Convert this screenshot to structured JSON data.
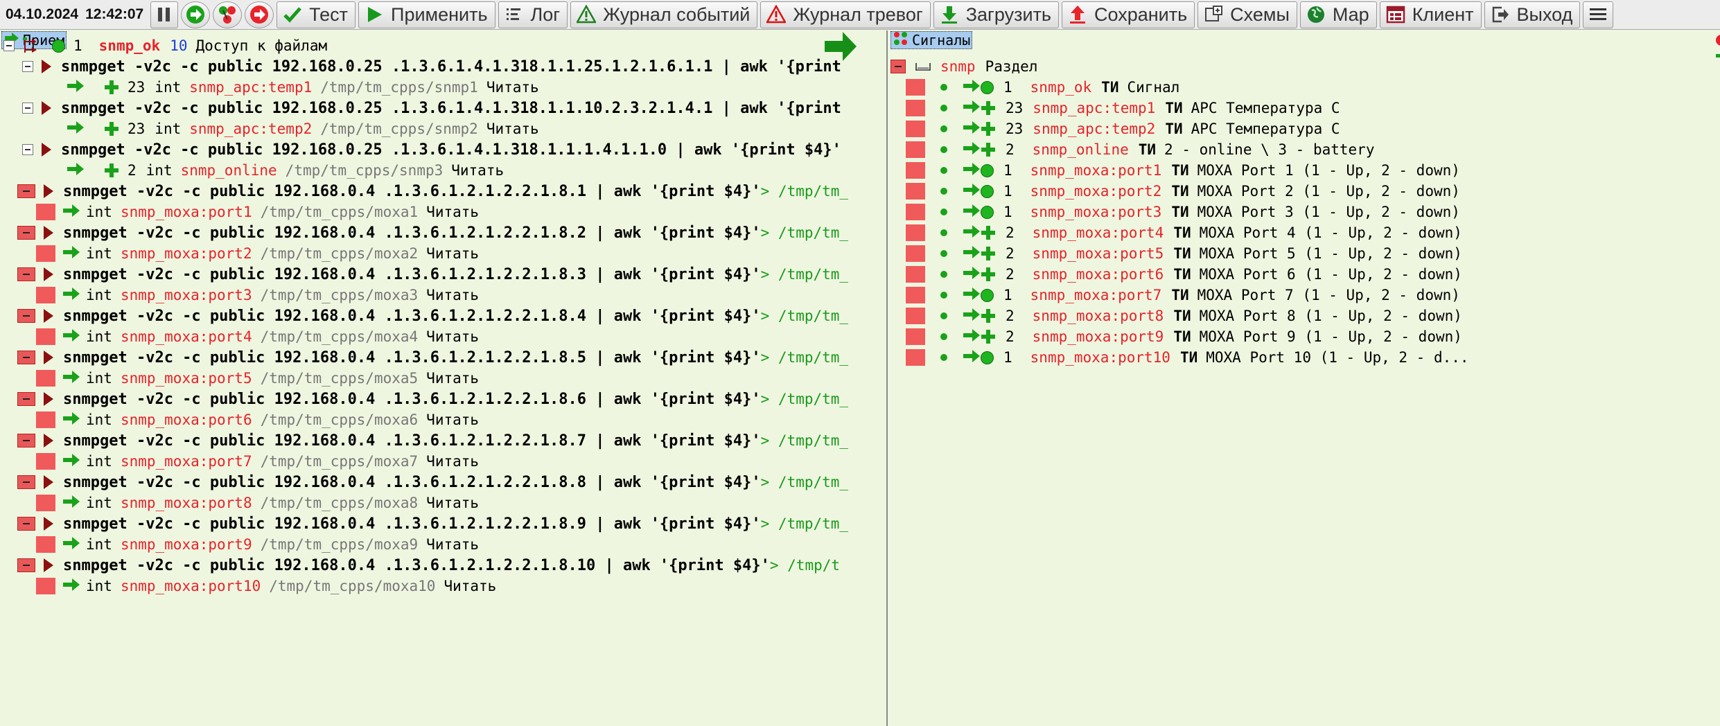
{
  "toolbar": {
    "date": "04.10.2024",
    "time": "12:42:07",
    "buttons": {
      "test": "Тест",
      "apply": "Применить",
      "log": "Лог",
      "events": "Журнал событий",
      "alarms": "Журнал тревог",
      "load": "Загрузить",
      "save": "Сохранить",
      "schemes": "Схемы",
      "map": "Мар",
      "client": "Клиент",
      "exit": "Выход"
    },
    "icons": {
      "pause": "pause-icon",
      "forward": "green-forward-icon",
      "tree": "tree-icon",
      "red_forward": "red-forward-icon",
      "test": "checkmark-icon",
      "apply": "play-icon",
      "log": "log-icon",
      "events": "warning-icon",
      "alarms": "warning-red-icon",
      "load": "download-icon",
      "save": "upload-icon",
      "schemes": "schemes-icon",
      "map": "globe-icon",
      "client": "client-icon",
      "exit": "exit-icon",
      "menu": "menu-icon"
    }
  },
  "left": {
    "header": "Прием",
    "root": {
      "num": "1",
      "name": "snmp_ok",
      "count": "10",
      "desc": "Доступ к файлам"
    },
    "groups": [
      {
        "style": "white",
        "cmd": "snmpget -v2c -c public 192.168.0.25 .1.3.6.1.4.1.318.1.1.25.1.2.1.6.1.1 | awk '{print",
        "tail": "",
        "child": {
          "icon": "plus",
          "num": "23",
          "type": "int",
          "name": "snmp_apc:temp1",
          "path": "/tmp/tm_cpps/snmp1",
          "action": "Читать"
        }
      },
      {
        "style": "white",
        "cmd": "snmpget -v2c -c public 192.168.0.25 .1.3.6.1.4.1.318.1.1.10.2.3.2.1.4.1 | awk '{print",
        "tail": "",
        "child": {
          "icon": "plus",
          "num": "23",
          "type": "int",
          "name": "snmp_apc:temp2",
          "path": "/tmp/tm_cpps/snmp2",
          "action": "Читать"
        }
      },
      {
        "style": "white",
        "cmd": "snmpget -v2c -c public 192.168.0.25 .1.3.6.1.4.1.318.1.1.1.4.1.1.0 | awk '{print $4}'",
        "tail": "",
        "child": {
          "icon": "plus",
          "num": "2",
          "type": "int",
          "name": "snmp_online",
          "path": "/tmp/tm_cpps/snmp3",
          "action": "Читать"
        }
      },
      {
        "style": "red",
        "cmd": "snmpget -v2c -c public 192.168.0.4 .1.3.6.1.2.1.2.2.1.8.1 | awk '{print $4}'",
        "tail": " > /tmp/tm_",
        "child": {
          "icon": "sq",
          "num": "",
          "type": "int",
          "name": "snmp_moxa:port1",
          "path": "/tmp/tm_cpps/moxa1",
          "action": "Читать"
        }
      },
      {
        "style": "red",
        "cmd": "snmpget -v2c -c public 192.168.0.4 .1.3.6.1.2.1.2.2.1.8.2 | awk '{print $4}'",
        "tail": " > /tmp/tm_",
        "child": {
          "icon": "sq",
          "num": "",
          "type": "int",
          "name": "snmp_moxa:port2",
          "path": "/tmp/tm_cpps/moxa2",
          "action": "Читать"
        }
      },
      {
        "style": "red",
        "cmd": "snmpget -v2c -c public 192.168.0.4 .1.3.6.1.2.1.2.2.1.8.3 | awk '{print $4}'",
        "tail": " > /tmp/tm_",
        "child": {
          "icon": "sq",
          "num": "",
          "type": "int",
          "name": "snmp_moxa:port3",
          "path": "/tmp/tm_cpps/moxa3",
          "action": "Читать"
        }
      },
      {
        "style": "red",
        "cmd": "snmpget -v2c -c public 192.168.0.4 .1.3.6.1.2.1.2.2.1.8.4 | awk '{print $4}'",
        "tail": " > /tmp/tm_",
        "child": {
          "icon": "sq",
          "num": "",
          "type": "int",
          "name": "snmp_moxa:port4",
          "path": "/tmp/tm_cpps/moxa4",
          "action": "Читать"
        }
      },
      {
        "style": "red",
        "cmd": "snmpget -v2c -c public 192.168.0.4 .1.3.6.1.2.1.2.2.1.8.5 | awk '{print $4}'",
        "tail": " > /tmp/tm_",
        "child": {
          "icon": "sq",
          "num": "",
          "type": "int",
          "name": "snmp_moxa:port5",
          "path": "/tmp/tm_cpps/moxa5",
          "action": "Читать"
        }
      },
      {
        "style": "red",
        "cmd": "snmpget -v2c -c public 192.168.0.4 .1.3.6.1.2.1.2.2.1.8.6 | awk '{print $4}'",
        "tail": " > /tmp/tm_",
        "child": {
          "icon": "sq",
          "num": "",
          "type": "int",
          "name": "snmp_moxa:port6",
          "path": "/tmp/tm_cpps/moxa6",
          "action": "Читать"
        }
      },
      {
        "style": "red",
        "cmd": "snmpget -v2c -c public 192.168.0.4 .1.3.6.1.2.1.2.2.1.8.7 | awk '{print $4}'",
        "tail": " > /tmp/tm_",
        "child": {
          "icon": "sq",
          "num": "",
          "type": "int",
          "name": "snmp_moxa:port7",
          "path": "/tmp/tm_cpps/moxa7",
          "action": "Читать"
        }
      },
      {
        "style": "red",
        "cmd": "snmpget -v2c -c public 192.168.0.4 .1.3.6.1.2.1.2.2.1.8.8 | awk '{print $4}'",
        "tail": " > /tmp/tm_",
        "child": {
          "icon": "sq",
          "num": "",
          "type": "int",
          "name": "snmp_moxa:port8",
          "path": "/tmp/tm_cpps/moxa8",
          "action": "Читать"
        }
      },
      {
        "style": "red",
        "cmd": "snmpget -v2c -c public 192.168.0.4 .1.3.6.1.2.1.2.2.1.8.9 | awk '{print $4}'",
        "tail": " > /tmp/tm_",
        "child": {
          "icon": "sq",
          "num": "",
          "type": "int",
          "name": "snmp_moxa:port9",
          "path": "/tmp/tm_cpps/moxa9",
          "action": "Читать"
        }
      },
      {
        "style": "red",
        "cmd": "snmpget -v2c -c public 192.168.0.4 .1.3.6.1.2.1.2.2.1.8.10 | awk '{print $4}'",
        "tail": " > /tmp/t",
        "child": {
          "icon": "sq",
          "num": "",
          "type": "int",
          "name": "snmp_moxa:port10",
          "path": "/tmp/tm_cpps/moxa10",
          "action": "Читать"
        }
      }
    ]
  },
  "right": {
    "header": "Сигналы",
    "root": {
      "name": "snmp",
      "desc": "Раздел"
    },
    "signals": [
      {
        "icon": "circle",
        "num": "1",
        "name": "snmp_ok",
        "kind": "ТИ",
        "desc": "Сигнал"
      },
      {
        "icon": "plus",
        "num": "23",
        "name": "snmp_apc:temp1",
        "kind": "ТИ",
        "desc": "APC Температура С"
      },
      {
        "icon": "plus",
        "num": "23",
        "name": "snmp_apc:temp2",
        "kind": "ТИ",
        "desc": "APC Температура С"
      },
      {
        "icon": "plus",
        "num": "2",
        "name": "snmp_online",
        "kind": "ТИ",
        "desc": "2 - online \\ 3 - battery"
      },
      {
        "icon": "circle",
        "num": "1",
        "name": "snmp_moxa:port1",
        "kind": "ТИ",
        "desc": "MOXA Port 1 (1 - Up, 2 - down)"
      },
      {
        "icon": "circle",
        "num": "1",
        "name": "snmp_moxa:port2",
        "kind": "ТИ",
        "desc": "MOXA Port 2 (1 - Up, 2 - down)"
      },
      {
        "icon": "circle",
        "num": "1",
        "name": "snmp_moxa:port3",
        "kind": "ТИ",
        "desc": "MOXA Port 3 (1 - Up, 2 - down)"
      },
      {
        "icon": "plus",
        "num": "2",
        "name": "snmp_moxa:port4",
        "kind": "ТИ",
        "desc": "MOXA Port 4 (1 - Up, 2 - down)"
      },
      {
        "icon": "plus",
        "num": "2",
        "name": "snmp_moxa:port5",
        "kind": "ТИ",
        "desc": "MOXA Port 5 (1 - Up, 2 - down)"
      },
      {
        "icon": "plus",
        "num": "2",
        "name": "snmp_moxa:port6",
        "kind": "ТИ",
        "desc": "MOXA Port 6 (1 - Up, 2 - down)"
      },
      {
        "icon": "circle",
        "num": "1",
        "name": "snmp_moxa:port7",
        "kind": "ТИ",
        "desc": "MOXA Port 7 (1 - Up, 2 - down)"
      },
      {
        "icon": "plus",
        "num": "2",
        "name": "snmp_moxa:port8",
        "kind": "ТИ",
        "desc": "MOXA Port 8 (1 - Up, 2 - down)"
      },
      {
        "icon": "plus",
        "num": "2",
        "name": "snmp_moxa:port9",
        "kind": "ТИ",
        "desc": "MOXA Port 9 (1 - Up, 2 - down)"
      },
      {
        "icon": "circle",
        "num": "1",
        "name": "snmp_moxa:port10",
        "kind": "ТИ",
        "desc": "MOXA Port 10 (1 - Up, 2 - d..."
      }
    ]
  },
  "colors": {
    "background": "#eef6e0",
    "accent_red": "#e8232a",
    "accent_green": "#1aa21a",
    "header_bg": "#a8ccef"
  }
}
